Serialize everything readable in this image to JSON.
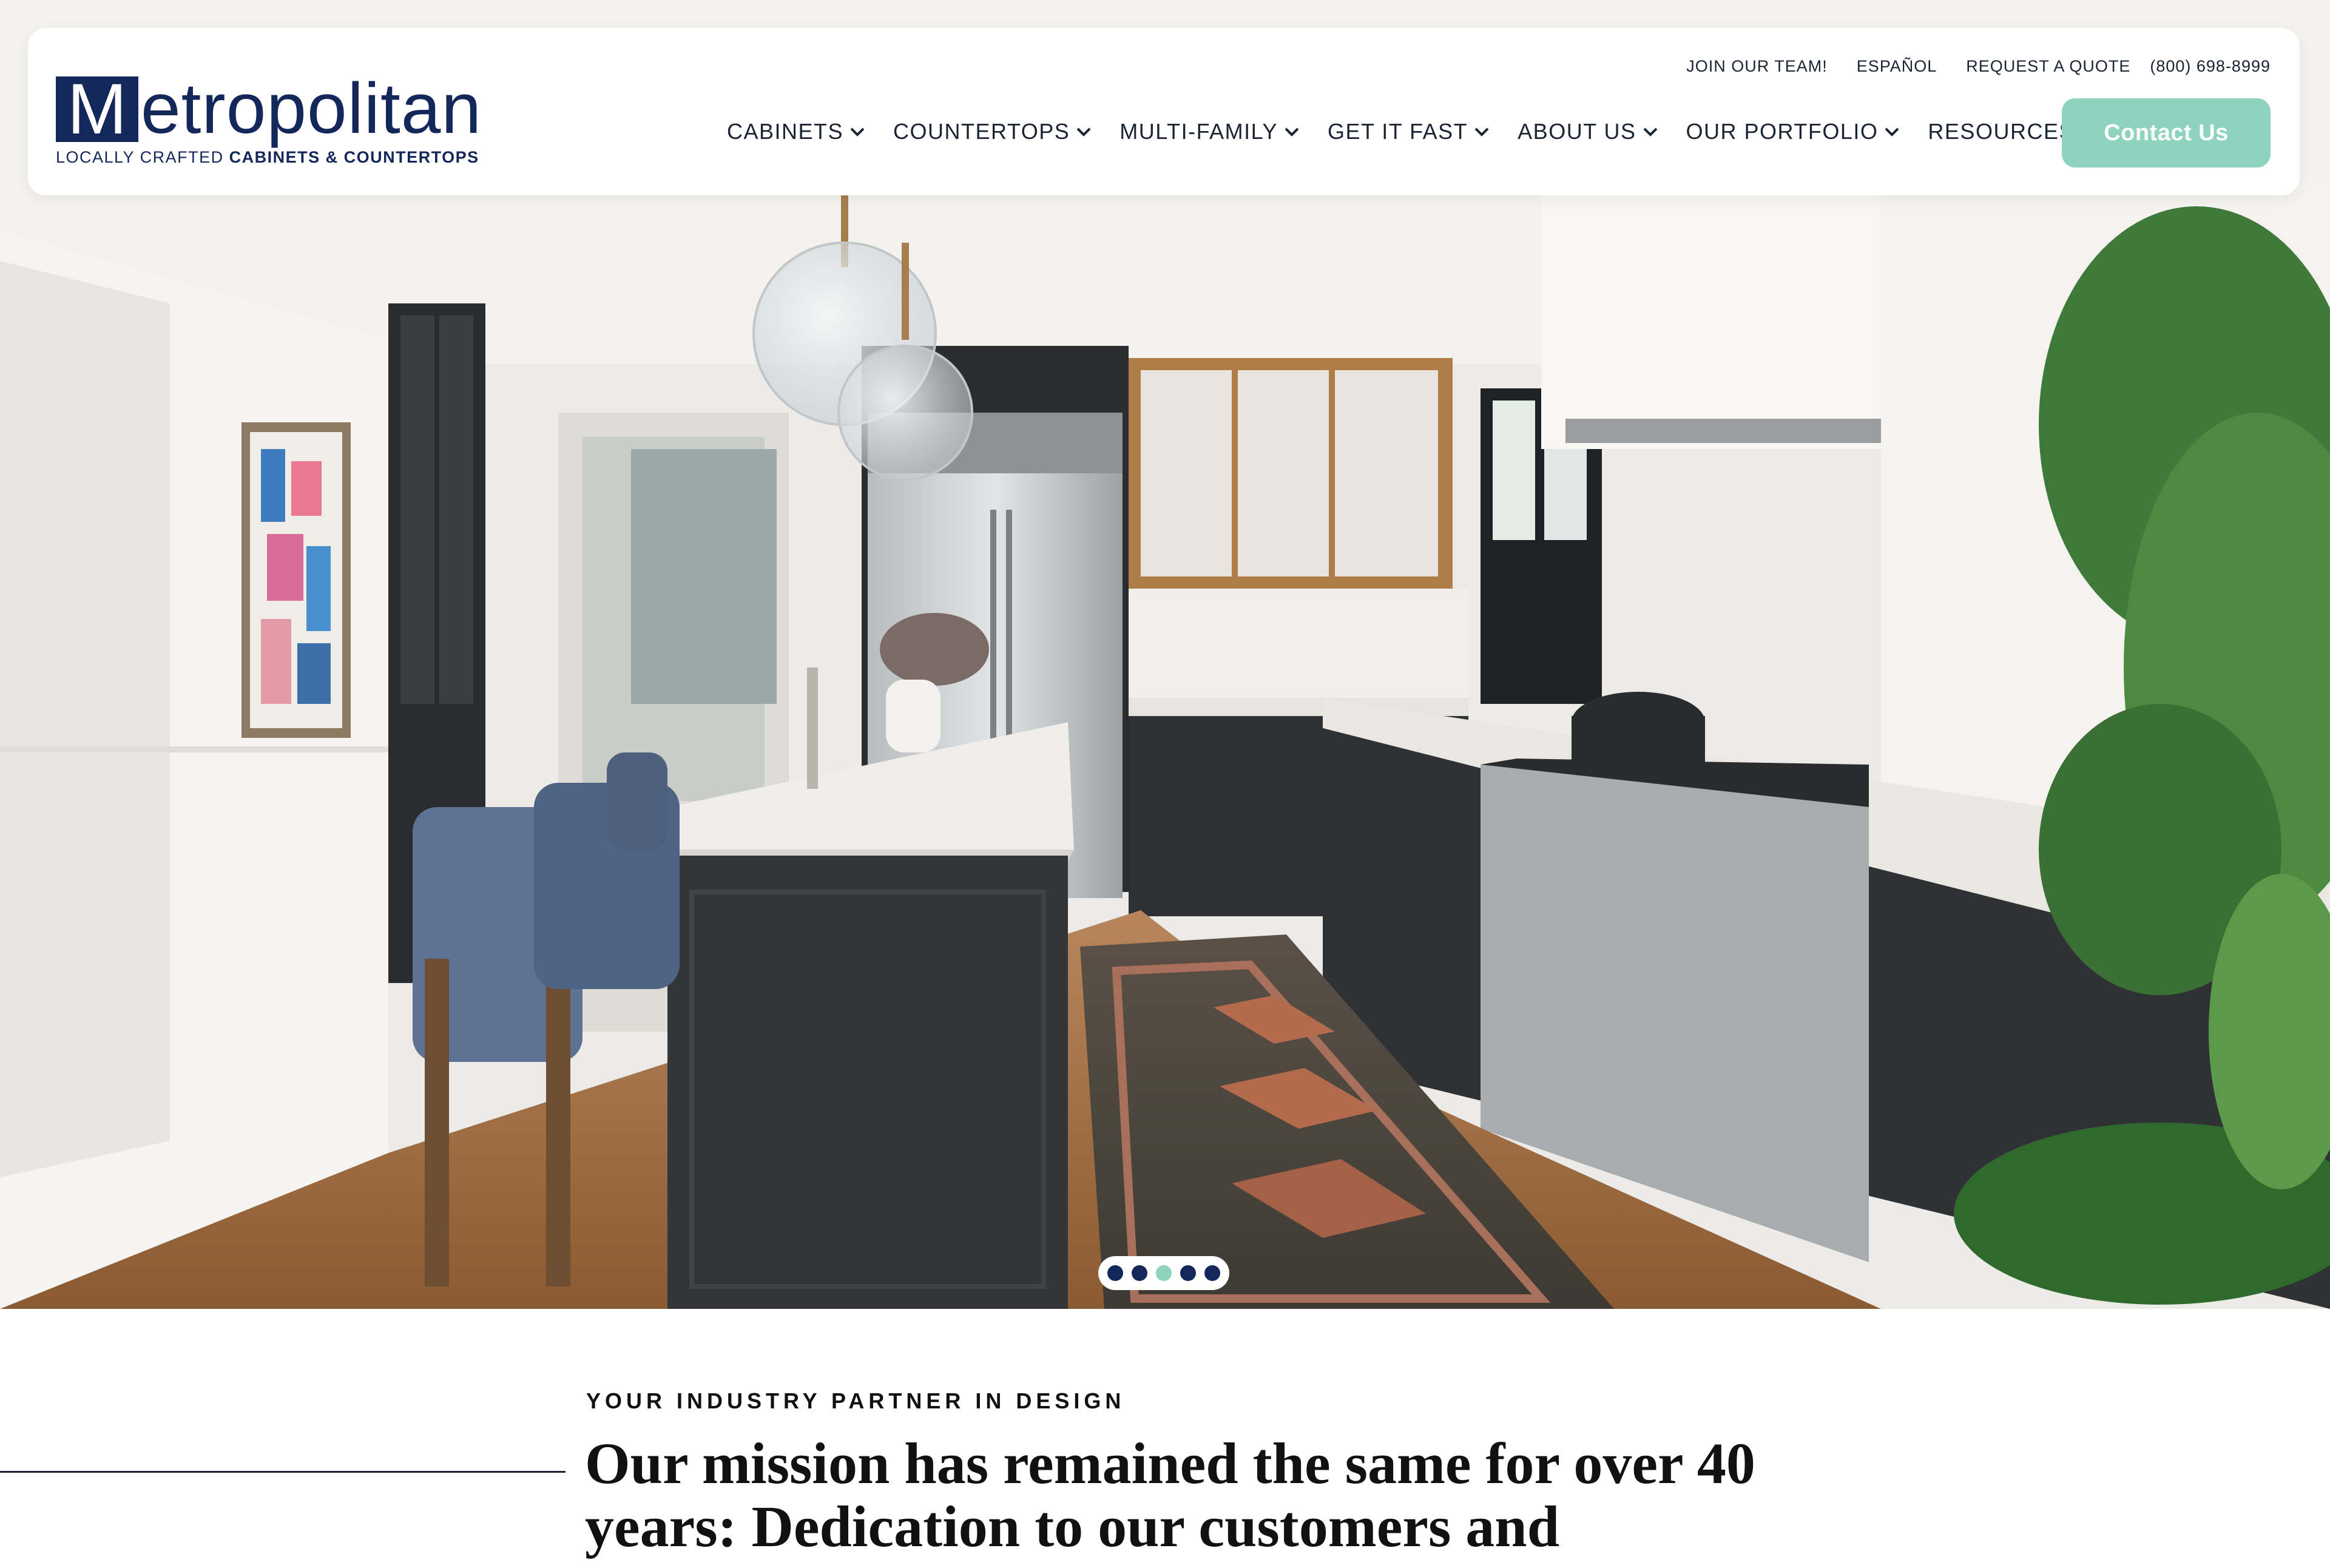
{
  "brand": {
    "logo_letter": "M",
    "logo_rest": "etropolitan",
    "tagline_light": "LOCALLY CRAFTED ",
    "tagline_bold": "CABINETS & COUNTERTOPS",
    "navy": "#14275a",
    "mint": "#8ed3bd"
  },
  "utility_nav": [
    "JOIN OUR TEAM!",
    "ESPAÑOL",
    "REQUEST A QUOTE",
    "(800) 698-8999"
  ],
  "main_nav": [
    {
      "label": "CABINETS",
      "icon": "chevron-down-icon"
    },
    {
      "label": "COUNTERTOPS",
      "icon": "chevron-down-icon"
    },
    {
      "label": "MULTI-FAMILY",
      "icon": "chevron-down-icon"
    },
    {
      "label": "GET IT FAST",
      "icon": "chevron-down-icon"
    },
    {
      "label": "ABOUT US",
      "icon": "chevron-down-icon"
    },
    {
      "label": "OUR PORTFOLIO",
      "icon": "chevron-down-icon"
    },
    {
      "label": "RESOURCES",
      "icon": "chevron-down-icon"
    }
  ],
  "contact_button": "Contact Us",
  "hero": {
    "image": "kitchen-photo",
    "slides_total": 5,
    "active_slide": 3
  },
  "intro": {
    "eyebrow": "YOUR INDUSTRY PARTNER IN DESIGN",
    "mission_line1": "Our mission has remained the same for over 40",
    "mission_line2": "years: Dedication to our customers and"
  }
}
